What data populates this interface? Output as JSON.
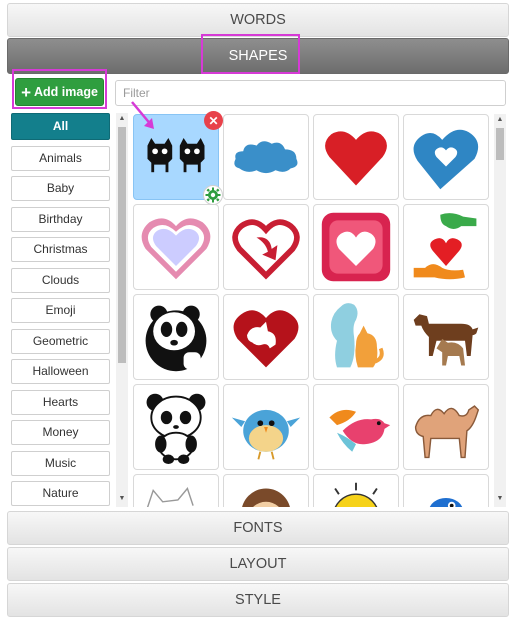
{
  "accordion": {
    "words": "WORDS",
    "shapes": "SHAPES",
    "fonts": "FONTS",
    "layout": "LAYOUT",
    "style": "STYLE"
  },
  "toolbar": {
    "add_image_label": "Add image",
    "filter_placeholder": "Filter",
    "filter_value": ""
  },
  "categories": [
    {
      "label": "All",
      "active": true
    },
    {
      "label": "Animals"
    },
    {
      "label": "Baby"
    },
    {
      "label": "Birthday"
    },
    {
      "label": "Christmas"
    },
    {
      "label": "Clouds"
    },
    {
      "label": "Emoji"
    },
    {
      "label": "Geometric"
    },
    {
      "label": "Halloween"
    },
    {
      "label": "Hearts"
    },
    {
      "label": "Money"
    },
    {
      "label": "Music"
    },
    {
      "label": "Nature"
    }
  ],
  "shapes": [
    {
      "icon": "cats-icon",
      "selected": true
    },
    {
      "icon": "cloud-icon"
    },
    {
      "icon": "heart-icon"
    },
    {
      "icon": "blue-heart-icon"
    },
    {
      "icon": "pink-heart-icon"
    },
    {
      "icon": "heart-arrow-icon"
    },
    {
      "icon": "heart-square-icon"
    },
    {
      "icon": "hands-heart-icon"
    },
    {
      "icon": "panda-icon"
    },
    {
      "icon": "heart-cat-dog-icon"
    },
    {
      "icon": "dog-cat-icon"
    },
    {
      "icon": "dogs-icon"
    },
    {
      "icon": "panda-cartoon-icon"
    },
    {
      "icon": "blue-bird-icon"
    },
    {
      "icon": "pink-bird-icon"
    },
    {
      "icon": "camel-icon"
    },
    {
      "icon": "cat-sketch-icon"
    },
    {
      "icon": "monkey-icon"
    },
    {
      "icon": "sun-icon"
    },
    {
      "icon": "blue-bird-2-icon"
    }
  ],
  "colors": {
    "active_header": "#7c7c7c",
    "add_button": "#2f9e3f",
    "active_category": "#137f8c",
    "selected_tile": "#a8d8ff",
    "highlight": "#d63ad6"
  }
}
